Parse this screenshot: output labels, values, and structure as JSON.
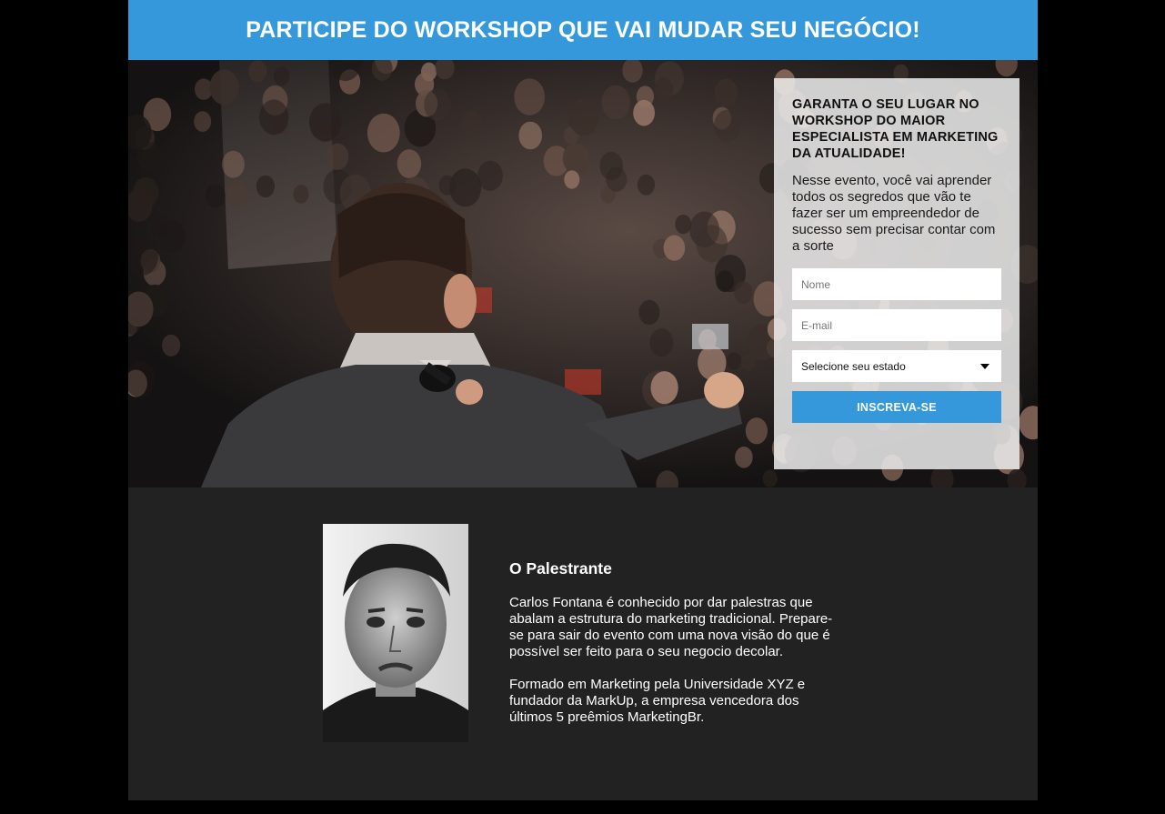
{
  "banner": {
    "title": "PARTICIPE DO WORKSHOP QUE VAI MUDAR SEU NEGÓCIO!"
  },
  "signup": {
    "title": "GARANTA O SEU LUGAR NO WORKSHOP DO MAIOR ESPECIALISTA EM MARKETING DA ATUALIDADE!",
    "description": "Nesse evento, você vai aprender todos os segredos que vão te fazer ser um empreendedor de sucesso sem precisar contar com a sorte",
    "name_placeholder": "Nome",
    "email_placeholder": "E-mail",
    "state_select_value": "Selecione seu estado",
    "submit_label": "INSCREVA-SE"
  },
  "speaker": {
    "heading": "O Palestrante",
    "paragraph_1": "Carlos Fontana é conhecido por dar palestras que abalam a estrutura do marketing tradicional. Prepare-se para sair do evento com uma nova visão do que é possível ser feito para o seu negocio decolar.",
    "paragraph_2": "Formado em Marketing pela Universidade XYZ e fundador da MarkUp, a empresa vencedora dos últimos 5 preêmios MarketingBr."
  },
  "colors": {
    "accent": "#3498db",
    "page_background": "#000000",
    "section_background": "#222222"
  },
  "icons": {
    "select_arrow": "caret-down-icon"
  }
}
